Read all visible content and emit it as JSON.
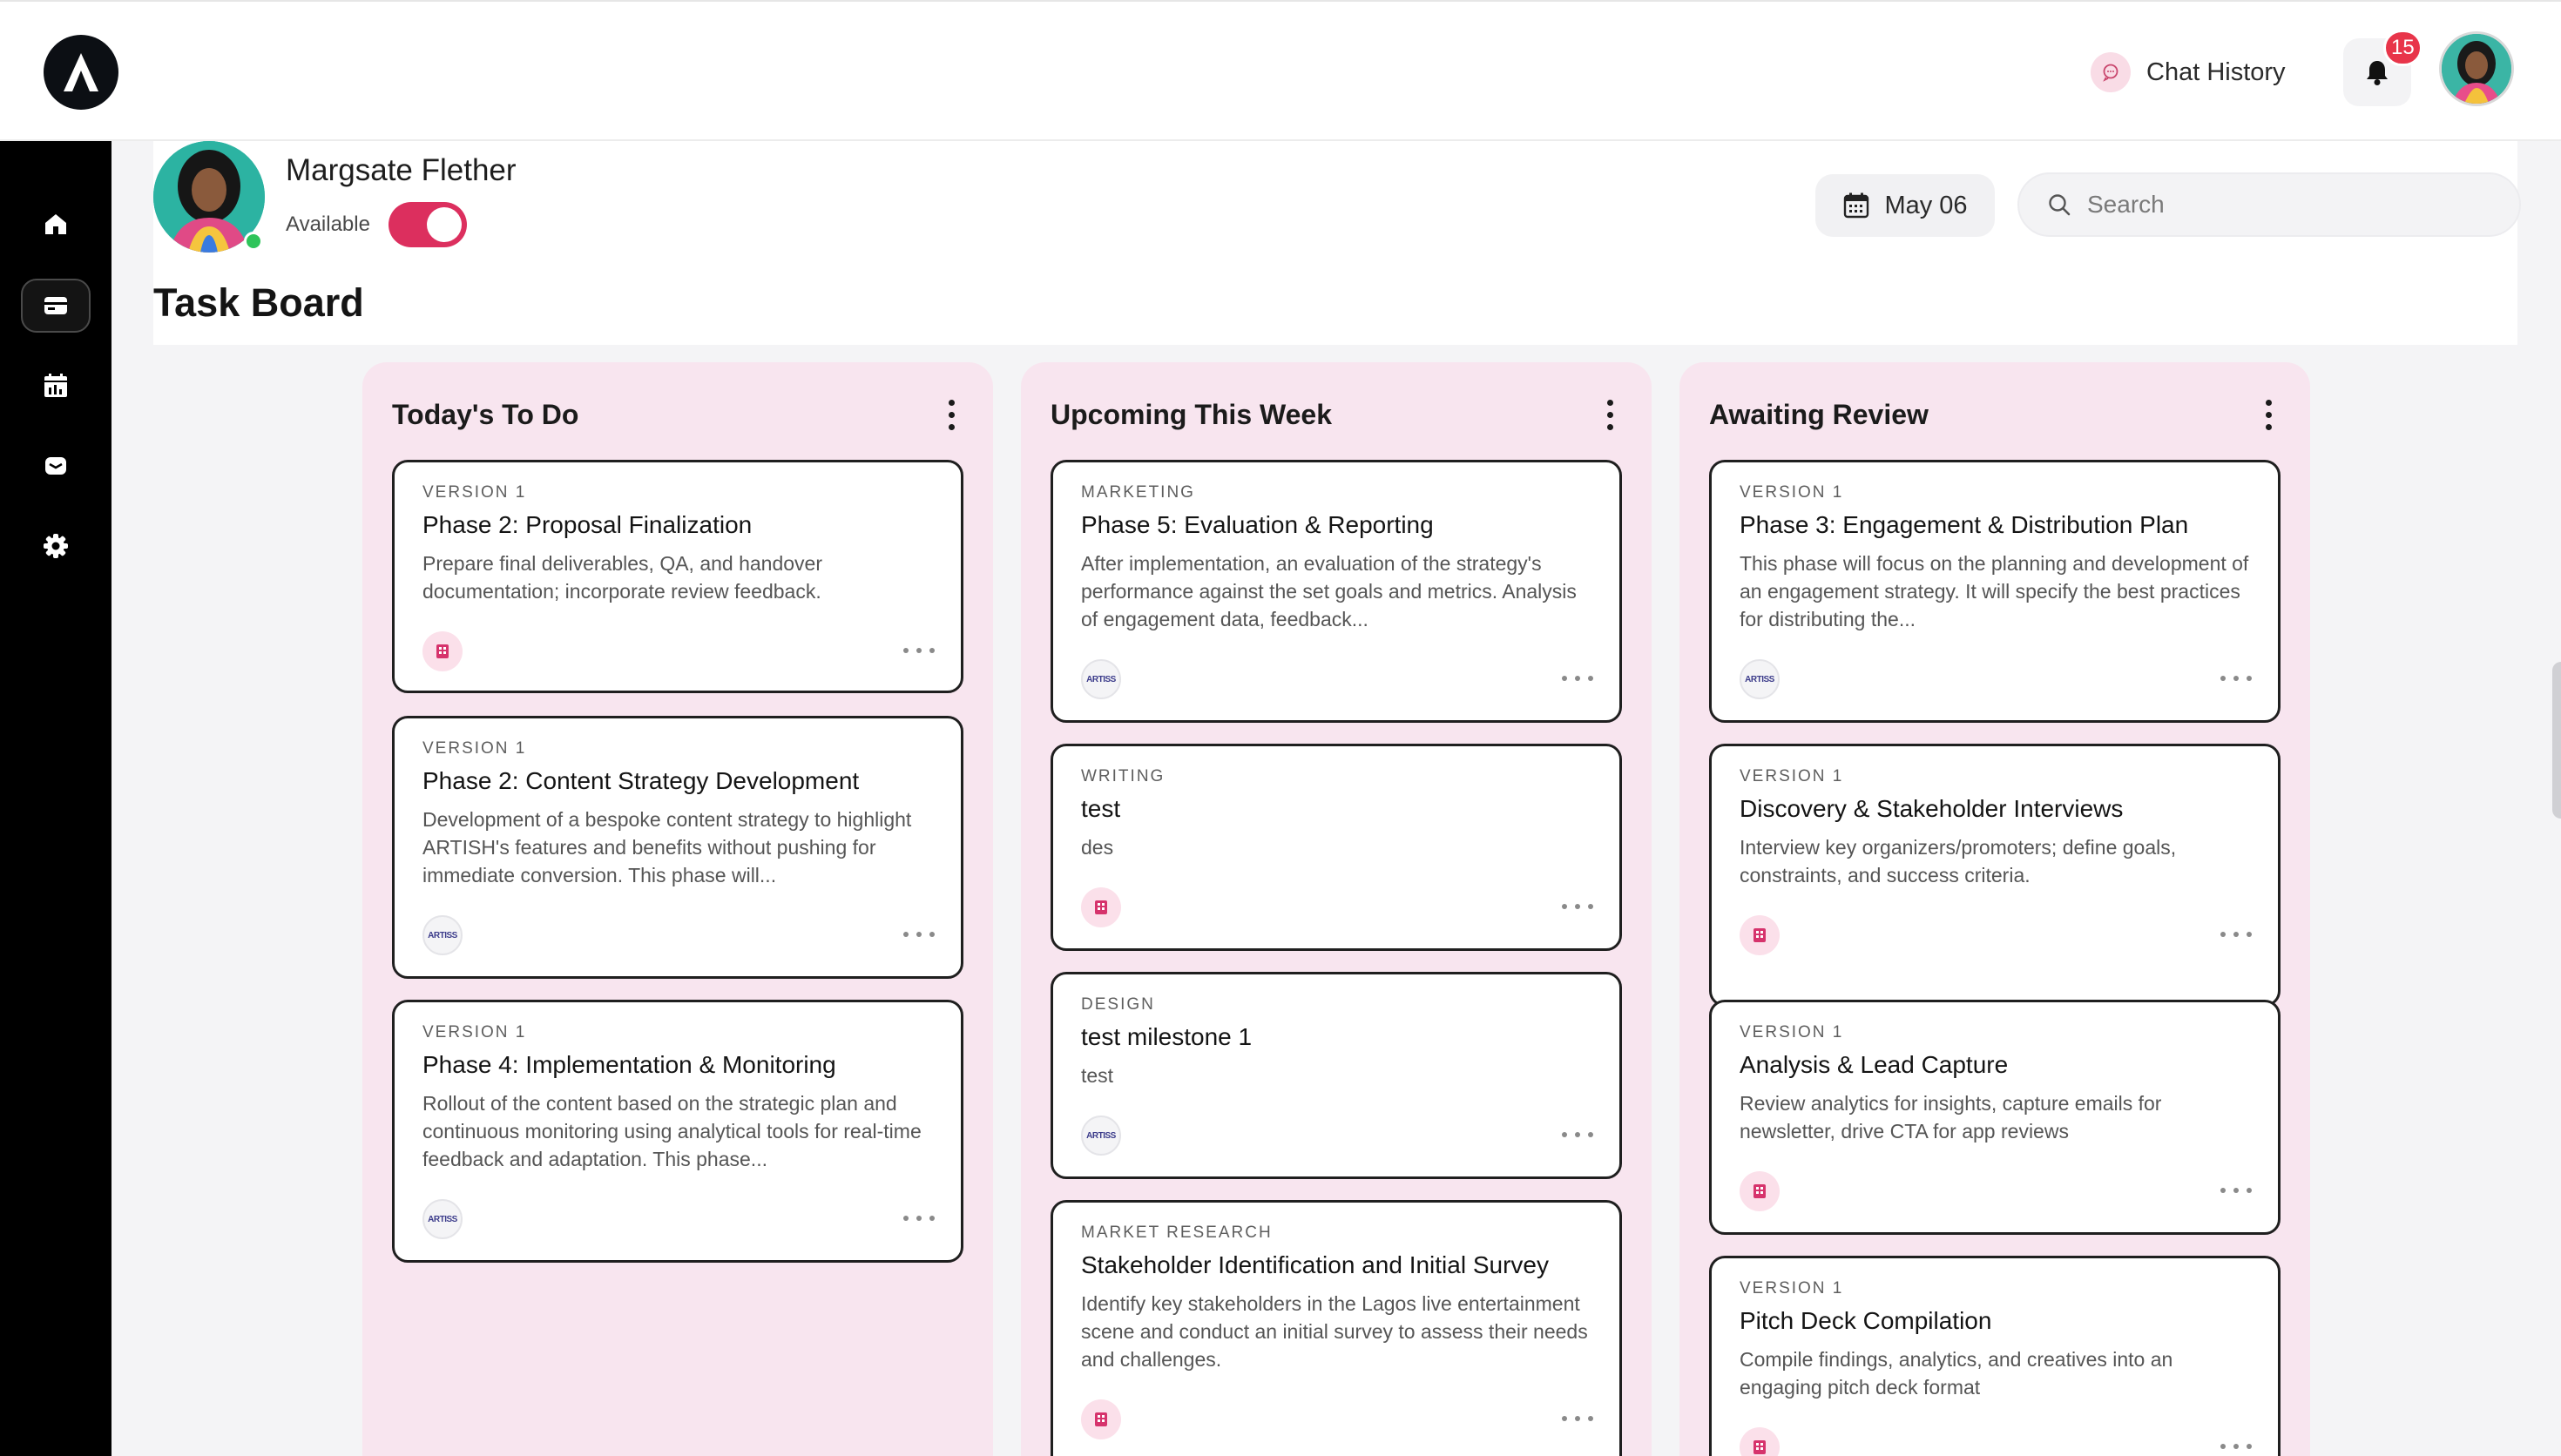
{
  "topbar": {
    "chat_history_label": "Chat History",
    "notification_count": "15"
  },
  "sidebar": {
    "items": [
      {
        "icon": "home-icon"
      },
      {
        "icon": "task-board-icon",
        "active": true
      },
      {
        "icon": "calendar-chart-icon"
      },
      {
        "icon": "inbox-icon"
      },
      {
        "icon": "gear-icon"
      }
    ]
  },
  "profile": {
    "name": "Margsate Flether",
    "availability_label": "Available",
    "available": true
  },
  "toolbar": {
    "date": "May 06",
    "search_placeholder": "Search"
  },
  "page": {
    "title": "Task Board"
  },
  "columns": [
    {
      "title": "Today's To Do",
      "cards": [
        {
          "category": "VERSION 1",
          "title": "Phase 2: Proposal Finalization",
          "desc": "Prepare final deliverables, QA, and handover documentation; incorporate review feedback.",
          "icon": "pink"
        },
        {
          "category": "VERSION 1",
          "title": "Phase 2: Content Strategy Development",
          "desc": "Development of a bespoke content strategy to highlight ARTISH's features and benefits without pushing for immediate conversion. This phase will...",
          "icon": "logo"
        },
        {
          "category": "VERSION 1",
          "title": "Phase 4: Implementation & Monitoring",
          "desc": "Rollout of the content based on the strategic plan and continuous monitoring using analytical tools for real-time feedback and adaptation. This phase...",
          "icon": "logo"
        }
      ]
    },
    {
      "title": "Upcoming This Week",
      "cards": [
        {
          "category": "MARKETING",
          "title": "Phase 5: Evaluation & Reporting",
          "desc": "After implementation, an evaluation of the strategy's performance against the set goals and metrics. Analysis of engagement data, feedback...",
          "icon": "logo"
        },
        {
          "category": "WRITING",
          "title": "test",
          "desc": "des",
          "icon": "pink"
        },
        {
          "category": "DESIGN",
          "title": "test milestone 1",
          "desc": "test",
          "icon": "logo"
        },
        {
          "category": "MARKET RESEARCH",
          "title": "Stakeholder Identification and Initial Survey",
          "desc": "Identify key stakeholders in the Lagos live entertainment scene and conduct an initial survey to assess their needs and challenges.",
          "icon": "pink"
        }
      ]
    },
    {
      "title": "Awaiting Review",
      "cards": [
        {
          "category": "VERSION 1",
          "title": "Phase 3: Engagement & Distribution Plan",
          "desc": "This phase will focus on the planning and development of an engagement strategy. It will specify the best practices for distributing the...",
          "icon": "logo"
        },
        {
          "category": "VERSION 1",
          "title": "Discovery & Stakeholder Interviews",
          "desc": "Interview key organizers/promoters; define goals, constraints, and success criteria.",
          "icon": "pink"
        },
        {
          "category": "VERSION 1",
          "title": "Analysis & Lead Capture",
          "desc": "Review analytics for insights, capture emails for newsletter, drive CTA for app reviews",
          "icon": "pink"
        },
        {
          "category": "VERSION 1",
          "title": "Pitch Deck Compilation",
          "desc": "Compile findings, analytics, and creatives into an engaging pitch deck format",
          "icon": "pink"
        }
      ]
    }
  ],
  "logo_badge_text": "ARTISS",
  "colors": {
    "accent": "#dc2f5e",
    "column_bg": "#f8e5ef",
    "sidebar_bg": "#000000",
    "badge": "#e8354a",
    "online": "#2ec45a"
  }
}
